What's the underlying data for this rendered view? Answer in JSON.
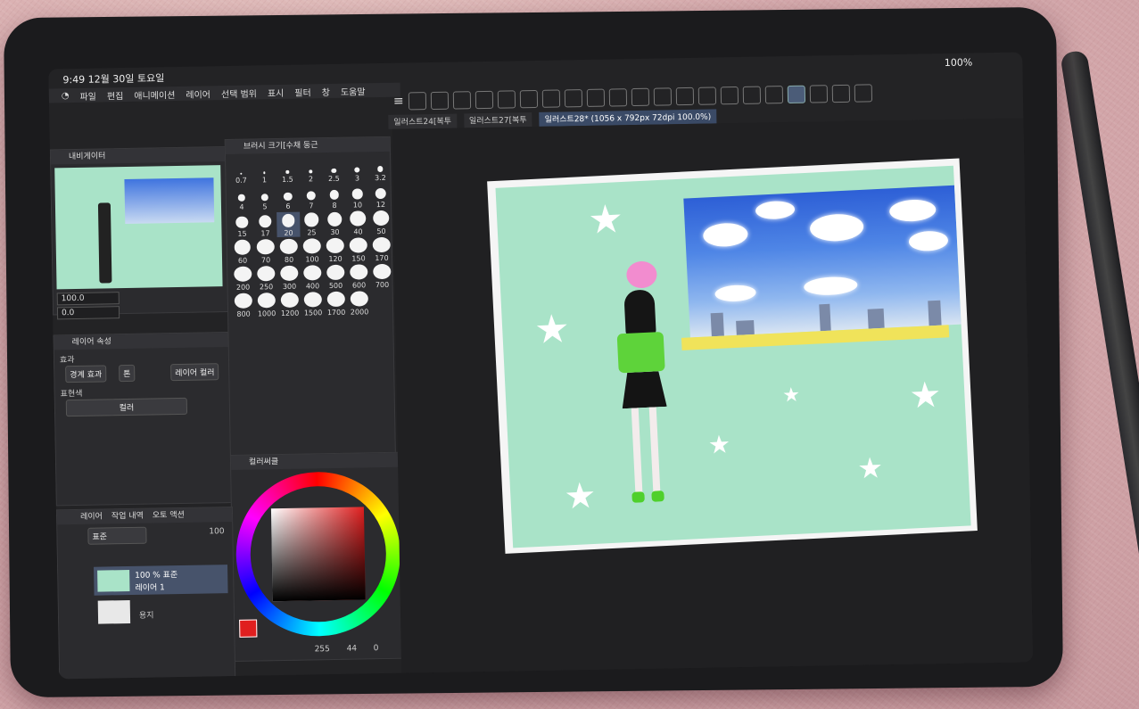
{
  "status": {
    "time_date": "9:49  12월 30일 토요일",
    "battery": "100%"
  },
  "menu": [
    "파일",
    "편집",
    "애니메이션",
    "레이어",
    "선택 범위",
    "표시",
    "필터",
    "창",
    "도움말"
  ],
  "tabs": [
    "일러스트24[복투",
    "일러스트27[복투",
    "일러스트28* (1056 x 792px 72dpi 100.0%)"
  ],
  "navigator": {
    "title": "내비게이터",
    "zoom": "100.0",
    "angle": "0.0"
  },
  "brush": {
    "title": "브러시 크기[수채 둥근",
    "sizes": [
      "0.7",
      "1",
      "1.5",
      "2",
      "2.5",
      "3",
      "3.2",
      "4",
      "5",
      "6",
      "7",
      "8",
      "10",
      "12",
      "15",
      "17",
      "20",
      "25",
      "30",
      "40",
      "50",
      "60",
      "70",
      "80",
      "100",
      "120",
      "150",
      "170",
      "200",
      "250",
      "300",
      "400",
      "500",
      "600",
      "700",
      "800",
      "1000",
      "1200",
      "1500",
      "1700",
      "2000"
    ],
    "selected": "20"
  },
  "layer_property": {
    "title": "레이어 속성",
    "effect_label": "효과",
    "border_effect": "경계 효과",
    "tone": "톤",
    "layer_color": "레이어 컬러",
    "expression_label": "표현색",
    "expression_value": "컬러"
  },
  "color": {
    "title": "컬러써클",
    "r": "255",
    "g": "44",
    "b": "0",
    "accent": "#e01f1f"
  },
  "layers": {
    "tabs": [
      "레이어",
      "작업 내역",
      "오토 액션"
    ],
    "blend": "표준",
    "opacity": "100",
    "items": [
      {
        "line1": "100 % 표준",
        "line2": "레이어 1"
      },
      {
        "line1": "용지",
        "line2": ""
      }
    ]
  }
}
